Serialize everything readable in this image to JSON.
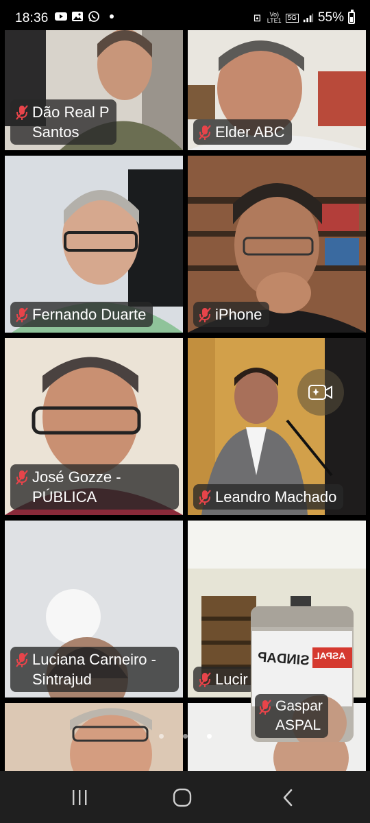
{
  "status_bar": {
    "time": "18:36",
    "notification_icons": [
      "youtube-icon",
      "gallery-icon",
      "whatsapp-icon"
    ],
    "network_label_top": "Vo)",
    "network_label_bottom": "LTE1",
    "network_type": "5G",
    "battery_percent": "55%"
  },
  "participants": [
    {
      "name": "Dão Real P\nSantos",
      "muted": true
    },
    {
      "name": "Elder ABC",
      "muted": true
    },
    {
      "name": "Fernando Duarte",
      "muted": true
    },
    {
      "name": "iPhone",
      "muted": true
    },
    {
      "name": "José Gozze -\nPÚBLICA",
      "muted": true
    },
    {
      "name": "Leandro Machado",
      "muted": true
    },
    {
      "name": "Luciana Carneiro -\nSintrajud",
      "muted": true
    },
    {
      "name": "Lucir",
      "muted": true
    },
    {
      "name": "",
      "muted": false
    },
    {
      "name": "",
      "muted": false
    }
  ],
  "self_view": {
    "name": "Gaspar\nASPAL",
    "banner_text_1": "ASPAL",
    "banner_text_2": "SINDAP",
    "muted": true
  },
  "camera_effects_button": "camera-sparkle-icon",
  "pagination": {
    "total": 3,
    "active_index": 2
  },
  "nav_bar": {
    "recents": "recents-icon",
    "home": "home-icon",
    "back": "back-icon"
  },
  "colors": {
    "label_bg": "#282828",
    "mute_red": "#e8444a",
    "nav_bg": "#1f1f1f"
  }
}
